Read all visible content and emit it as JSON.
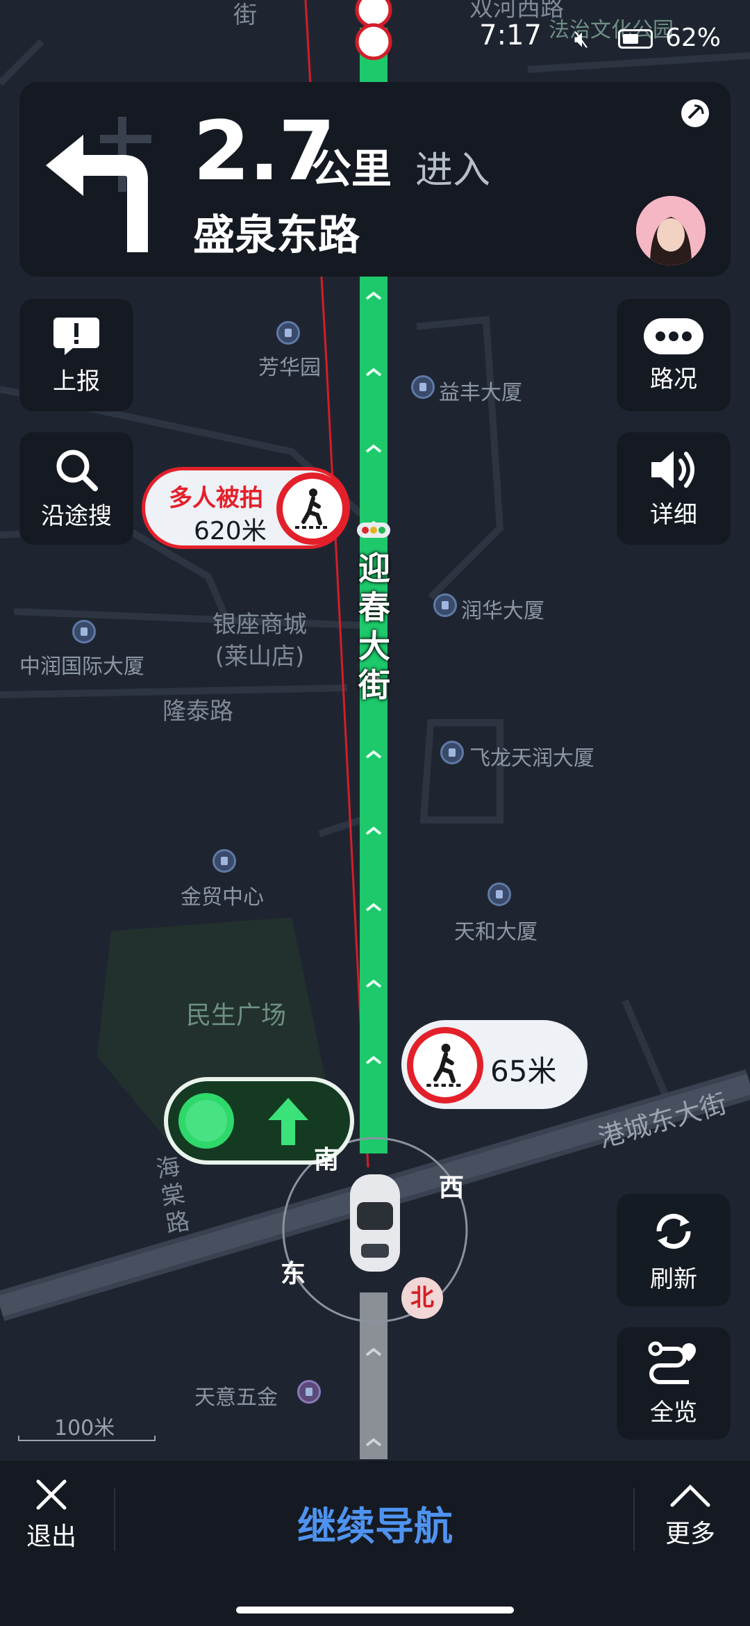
{
  "status_bar": {
    "time": "7:17",
    "battery": "62%"
  },
  "guidance": {
    "distance": "2.7",
    "unit": "公里",
    "action": "进入",
    "road": "盛泉东路"
  },
  "side_buttons": {
    "report": "上报",
    "along_search": "沿途搜",
    "traffic": "路况",
    "detail": "详细",
    "refresh": "刷新",
    "overview": "全览"
  },
  "alerts": {
    "camera_title": "多人被拍",
    "camera_distance": "620米",
    "crosswalk_distance": "65米"
  },
  "map_labels": {
    "current_road": "迎春大街",
    "pois": [
      {
        "name": "芳华园"
      },
      {
        "name": "益丰大厦"
      },
      {
        "name": "润华大厦"
      },
      {
        "name": "中润国际大厦"
      },
      {
        "name": "飞龙天润大厦"
      },
      {
        "name": "金贸中心"
      },
      {
        "name": "天和大厦"
      },
      {
        "name": "天意五金"
      }
    ],
    "mall": "银座商城(莱山店)",
    "roads": {
      "longtai": "隆泰路",
      "gangcheng": "港城东大街",
      "haitang": "海棠路"
    },
    "areas": {
      "minsheng": "民生广场",
      "top_right": "法治文化公园",
      "top_left": "街",
      "top_center": "双河西路"
    }
  },
  "compass": {
    "south": "南",
    "west": "西",
    "east": "东",
    "north": "北"
  },
  "scale": "100米",
  "bottom_bar": {
    "exit": "退出",
    "continue": "继续导航",
    "more": "更多"
  },
  "colors": {
    "route": "#1dc96b",
    "alert_red": "#e3202a",
    "accent_blue": "#4f93f0",
    "card_bg": "#141922"
  }
}
